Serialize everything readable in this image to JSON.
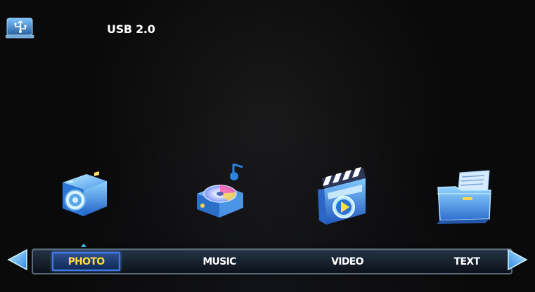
{
  "header": {
    "title": "USB 2.0",
    "icon": "usb-device-icon"
  },
  "media_icons": [
    {
      "name": "photo",
      "icon": "camera-icon"
    },
    {
      "name": "music",
      "icon": "music-player-icon"
    },
    {
      "name": "video",
      "icon": "clapperboard-icon"
    },
    {
      "name": "text",
      "icon": "folder-document-icon"
    }
  ],
  "nav": {
    "left_arrow": "left-arrow-icon",
    "right_arrow": "right-arrow-icon",
    "tabs": [
      {
        "label": "PHOTO",
        "selected": true
      },
      {
        "label": "MUSIC",
        "selected": false
      },
      {
        "label": "VIDEO",
        "selected": false
      },
      {
        "label": "TEXT",
        "selected": false
      }
    ]
  },
  "colors": {
    "background": "#0b0a0b",
    "selected_text": "#ffd93b",
    "accent_blue": "#3e79ea",
    "arrow_blue": "#39a8f1"
  }
}
